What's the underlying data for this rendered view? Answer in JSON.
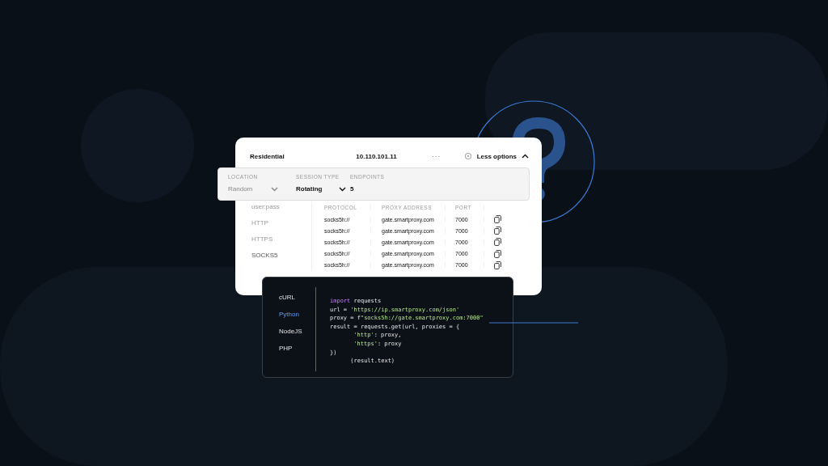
{
  "card": {
    "product": "Residential",
    "ip": "10.110.101.11",
    "more": "···",
    "options_toggle": "Less options"
  },
  "options_bar": {
    "fields": [
      {
        "label": "LOCATION",
        "value": "Random",
        "kind": "dropdown"
      },
      {
        "label": "SESSION TYPE",
        "value": "Rotating",
        "kind": "dropdown"
      },
      {
        "label": "ENDPOINTS",
        "value": "5",
        "kind": "number"
      }
    ]
  },
  "auth_tabs": [
    {
      "label": "user:pass",
      "selected": false
    },
    {
      "label": "HTTP",
      "selected": false
    },
    {
      "label": "HTTPS",
      "selected": false
    },
    {
      "label": "SOCKS5",
      "selected": true
    }
  ],
  "table": {
    "columns": [
      "PROTOCOL",
      "PROXY ADDRESS",
      "PORT"
    ],
    "rows": [
      [
        "socks5h://",
        "gate.smartproxy.com",
        "7000"
      ],
      [
        "socks5h://",
        "gate.smartproxy.com",
        "7000"
      ],
      [
        "socks5h://",
        "gate.smartproxy.com",
        "7000"
      ],
      [
        "socks5h://",
        "gate.smartproxy.com",
        "7000"
      ],
      [
        "socks5h://",
        "gate.smartproxy.com",
        "7000"
      ]
    ]
  },
  "code_panel": {
    "languages": [
      {
        "label": "cURL",
        "selected": false
      },
      {
        "label": "Python",
        "selected": true
      },
      {
        "label": "NodeJS",
        "selected": false
      },
      {
        "label": "PHP",
        "selected": false
      }
    ],
    "lines": [
      {
        "indented": false,
        "segments": [
          {
            "kind": "keyword",
            "text": "import"
          },
          {
            "kind": "plain",
            "text": " requests"
          }
        ]
      },
      {
        "indented": false,
        "segments": [
          {
            "kind": "plain",
            "text": "url = "
          },
          {
            "kind": "string",
            "text": "'https://ip.smartproxy.com/json'"
          }
        ]
      },
      {
        "indented": false,
        "segments": [
          {
            "kind": "plain",
            "text": "proxy = f"
          },
          {
            "kind": "string",
            "text": "\"socks5h://gate.smartproxy.com:7000\""
          }
        ]
      },
      {
        "indented": false,
        "segments": [
          {
            "kind": "plain",
            "text": "result = requests.get(url, proxies = {"
          }
        ]
      },
      {
        "indented": true,
        "segments": [
          {
            "kind": "string",
            "text": "'http'"
          },
          {
            "kind": "plain",
            "text": ": proxy,"
          }
        ]
      },
      {
        "indented": true,
        "segments": [
          {
            "kind": "string",
            "text": "'https'"
          },
          {
            "kind": "plain",
            "text": ": proxy"
          }
        ]
      },
      {
        "indented": false,
        "segments": [
          {
            "kind": "plain",
            "text": "})"
          }
        ]
      },
      {
        "indented": false,
        "segments": [
          {
            "kind": "plain",
            "text": "      (result.text)"
          }
        ]
      }
    ]
  }
}
